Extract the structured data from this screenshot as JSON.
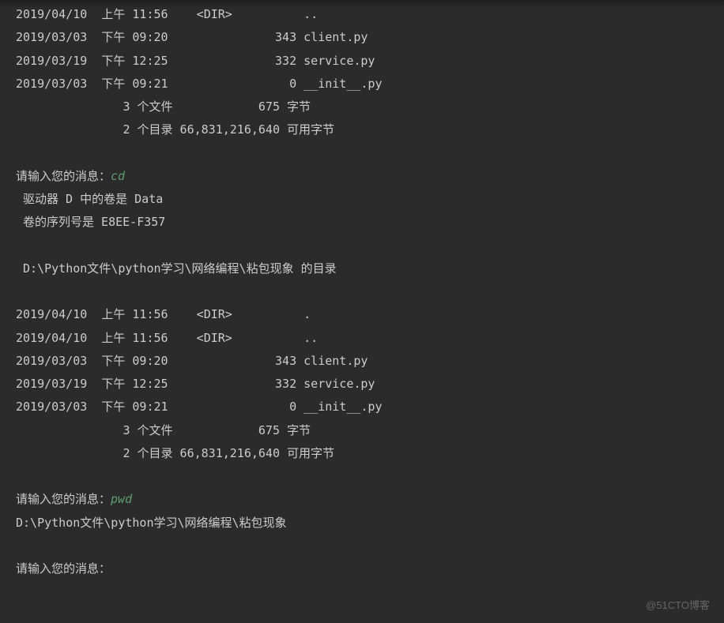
{
  "lines": [
    {
      "type": "plain",
      "text": "2019/04/10  上午 11:56    <DIR>          .."
    },
    {
      "type": "plain",
      "text": "2019/03/03  下午 09:20               343 client.py"
    },
    {
      "type": "plain",
      "text": "2019/03/19  下午 12:25               332 service.py"
    },
    {
      "type": "plain",
      "text": "2019/03/03  下午 09:21                 0 __init__.py"
    },
    {
      "type": "plain",
      "text": "               3 个文件            675 字节"
    },
    {
      "type": "plain",
      "text": "               2 个目录 66,831,216,640 可用字节"
    },
    {
      "type": "blank",
      "text": ""
    },
    {
      "type": "prompt",
      "prefix": "请输入您的消息：",
      "input": "cd"
    },
    {
      "type": "plain",
      "text": " 驱动器 D 中的卷是 Data"
    },
    {
      "type": "plain",
      "text": " 卷的序列号是 E8EE-F357"
    },
    {
      "type": "blank",
      "text": ""
    },
    {
      "type": "plain",
      "text": " D:\\Python文件\\python学习\\网络编程\\粘包现象 的目录"
    },
    {
      "type": "blank",
      "text": ""
    },
    {
      "type": "plain",
      "text": "2019/04/10  上午 11:56    <DIR>          ."
    },
    {
      "type": "plain",
      "text": "2019/04/10  上午 11:56    <DIR>          .."
    },
    {
      "type": "plain",
      "text": "2019/03/03  下午 09:20               343 client.py"
    },
    {
      "type": "plain",
      "text": "2019/03/19  下午 12:25               332 service.py"
    },
    {
      "type": "plain",
      "text": "2019/03/03  下午 09:21                 0 __init__.py"
    },
    {
      "type": "plain",
      "text": "               3 个文件            675 字节"
    },
    {
      "type": "plain",
      "text": "               2 个目录 66,831,216,640 可用字节"
    },
    {
      "type": "blank",
      "text": ""
    },
    {
      "type": "prompt",
      "prefix": "请输入您的消息：",
      "input": "pwd"
    },
    {
      "type": "plain",
      "text": "D:\\Python文件\\python学习\\网络编程\\粘包现象"
    },
    {
      "type": "blank",
      "text": ""
    },
    {
      "type": "prompt",
      "prefix": "请输入您的消息：",
      "input": ""
    }
  ],
  "watermark": "@51CTO博客"
}
